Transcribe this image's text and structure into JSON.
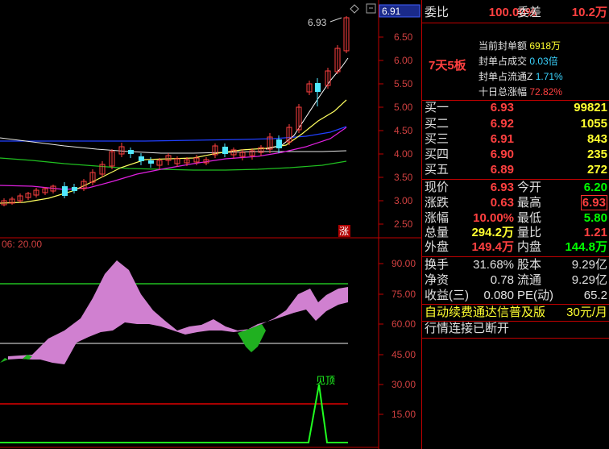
{
  "top_chart": {
    "price_ticks": [
      "6.50",
      "6.00",
      "5.50",
      "5.00",
      "4.50",
      "4.00",
      "3.50",
      "3.00",
      "2.50"
    ],
    "peak_label": "6.93",
    "current_price_tag": "6.91",
    "zhang_badge": "涨"
  },
  "indicator": {
    "params_label": "06: 20.00",
    "ticks": [
      "90.00",
      "75.00",
      "60.00",
      "45.00",
      "30.00",
      "15.00"
    ],
    "signal_label": "见顶"
  },
  "panel": {
    "weibi_label": "委比",
    "weibi_value": "100.00%",
    "weicha_label": "委差",
    "weicha_value": "10.2万",
    "board_tag": "7天5板",
    "seal": [
      {
        "label": "当前封单额",
        "value": "6918万"
      },
      {
        "label": "封单占成交",
        "value": "0.03倍"
      },
      {
        "label": "封单占流通Z",
        "value": "1.71%"
      },
      {
        "label": "十日总涨幅",
        "value": "72.82%"
      }
    ],
    "buy": [
      {
        "label": "买一",
        "price": "6.93",
        "vol": "99821"
      },
      {
        "label": "买二",
        "price": "6.92",
        "vol": "1055"
      },
      {
        "label": "买三",
        "price": "6.91",
        "vol": "843"
      },
      {
        "label": "买四",
        "price": "6.90",
        "vol": "235"
      },
      {
        "label": "买五",
        "price": "6.89",
        "vol": "272"
      }
    ],
    "quote": {
      "xianjia_label": "现价",
      "xianjia": "6.93",
      "jinkai_label": "今开",
      "jinkai": "6.20",
      "zhangdie_label": "涨跌",
      "zhangdie": "0.63",
      "zuigao_label": "最高",
      "zuigao": "6.93",
      "zhangfu_label": "涨幅",
      "zhangfu": "10.00%",
      "zuidi_label": "最低",
      "zuidi": "5.80",
      "zongliang_label": "总量",
      "zongliang": "294.2万",
      "liangbi_label": "量比",
      "liangbi": "1.21",
      "waipan_label": "外盘",
      "waipan": "149.4万",
      "neipan_label": "内盘",
      "neipan": "144.8万"
    },
    "fund": {
      "huanshou_label": "换手",
      "huanshou": "31.68%",
      "guben_label": "股本",
      "guben": "9.29亿",
      "jingzi_label": "净资",
      "jingzi": "0.78",
      "liutong_label": "流通",
      "liutong": "9.29亿",
      "shouyi_label": "收益(三)",
      "shouyi": "0.080",
      "pe_label": "PE(动)",
      "pe": "65.2"
    },
    "promo_text": "自动续费通达信普及版",
    "promo_price": "30元/月",
    "status_text": "行情连接已断开"
  },
  "colors": {
    "border": "#c00000",
    "rise": "#ff4040",
    "fall": "#00ff00",
    "ma_yellow": "#ffff60",
    "ma_magenta": "#e020e0",
    "ma_blue": "#2040ff",
    "fill_pink": "#d080d0"
  },
  "icons": [
    "diamond-icon",
    "scroll-button-icon"
  ]
}
